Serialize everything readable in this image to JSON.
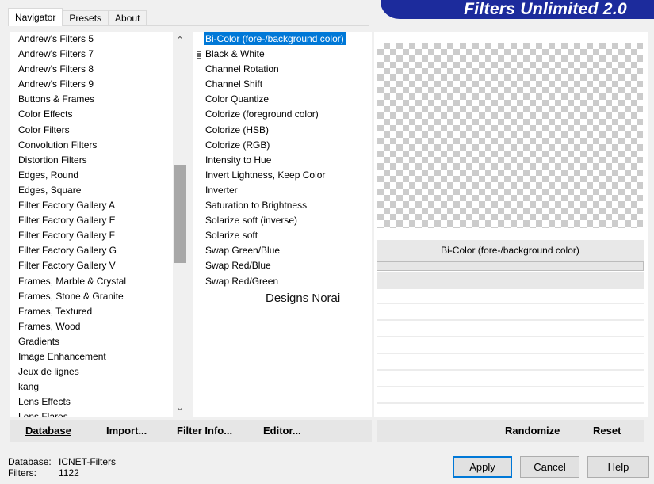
{
  "tabs": [
    "Navigator",
    "Presets",
    "About"
  ],
  "app_title": "Filters Unlimited 2.0",
  "categories": [
    "Andrew's Filters 5",
    "Andrew's Filters 7",
    "Andrew's Filters 8",
    "Andrew's Filters 9",
    "Buttons & Frames",
    "Color Effects",
    "Color Filters",
    "Convolution Filters",
    "Distortion Filters",
    "Edges, Round",
    "Edges, Square",
    "Filter Factory Gallery A",
    "Filter Factory Gallery E",
    "Filter Factory Gallery F",
    "Filter Factory Gallery G",
    "Filter Factory Gallery V",
    "Frames, Marble & Crystal",
    "Frames, Stone & Granite",
    "Frames, Textured",
    "Frames, Wood",
    "Gradients",
    "Image Enhancement",
    "Jeux de lignes",
    "kang",
    "Lens Effects",
    "Lens Flares"
  ],
  "selected_category": "Color Effects",
  "filters": [
    "Bi-Color (fore-/background color)",
    "Black & White",
    "Channel Rotation",
    "Channel Shift",
    "Color Quantize",
    "Colorize (foreground color)",
    "Colorize (HSB)",
    "Colorize (RGB)",
    "Intensity to Hue",
    "Invert Lightness, Keep Color",
    "Inverter",
    "Saturation to Brightness",
    "Solarize soft (inverse)",
    "Solarize soft",
    "Swap Green/Blue",
    "Swap Red/Blue",
    "Swap Red/Green"
  ],
  "selected_filter": "Bi-Color (fore-/background color)",
  "watermark": "Designs Norai",
  "preview": {
    "filter_name": "Bi-Color (fore-/background color)"
  },
  "toolbar": {
    "database": "Database",
    "import": "Import...",
    "filter_info": "Filter Info...",
    "editor": "Editor...",
    "randomize": "Randomize",
    "reset": "Reset"
  },
  "status": {
    "database_label": "Database:",
    "database_value": "ICNET-Filters",
    "filters_label": "Filters:",
    "filters_value": "1122"
  },
  "buttons": {
    "apply": "Apply",
    "cancel": "Cancel",
    "help": "Help"
  },
  "colors": {
    "banner": "#1c2b9c",
    "selection": "#0078d7"
  }
}
